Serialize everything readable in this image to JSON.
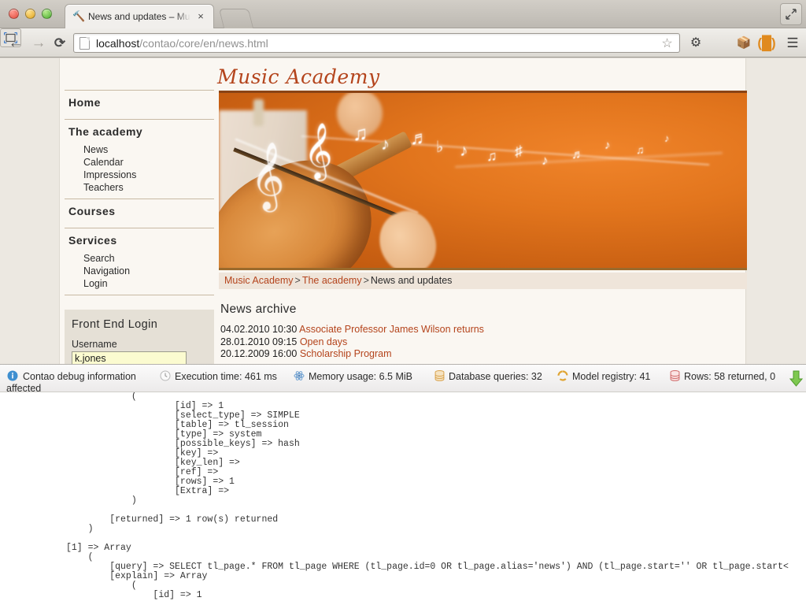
{
  "browser": {
    "window_controls": [
      "close",
      "minimize",
      "zoom"
    ],
    "expand_button": "fullscreen-expand",
    "tab": {
      "favicon": "hammer-icon",
      "title": "News and updates – Music Academy",
      "close_label": "×"
    },
    "new_tab_label": "",
    "nav": {
      "back": "←",
      "forward": "→",
      "reload": "⟳"
    },
    "omnibox": {
      "url_host": "localhost",
      "url_path": "/contao/core/en/news.html",
      "page_icon": "document-icon",
      "star": "☆"
    },
    "extensions": {
      "gear": "⚙",
      "frame": "screenshot-frame-icon",
      "box": "📦",
      "bracket": "(█)",
      "menu": "☰"
    }
  },
  "site": {
    "logo": "Music Academy",
    "nav": [
      {
        "label": "Home",
        "children": []
      },
      {
        "label": "The academy",
        "children": [
          "News",
          "Calendar",
          "Impressions",
          "Teachers"
        ]
      },
      {
        "label": "Courses",
        "children": []
      },
      {
        "label": "Services",
        "children": [
          "Search",
          "Navigation",
          "Login"
        ]
      }
    ],
    "login": {
      "title": "Front End Login",
      "username_label": "Username",
      "username_value": "k.jones",
      "username_placeholder": ""
    },
    "banner": {
      "alt": "violin-and-music-notes-banner",
      "notes": [
        "♫",
        "♪",
        "♬",
        "♫",
        "♪",
        "♬",
        "♪",
        "♫",
        "♪",
        "♬",
        "♪",
        "𝄞"
      ]
    },
    "breadcrumb": [
      {
        "label": "Music Academy",
        "link": true
      },
      {
        "label": "The academy",
        "link": true
      },
      {
        "label": "News and updates",
        "link": false
      }
    ],
    "breadcrumb_separator": ">",
    "news": {
      "heading": "News archive",
      "items": [
        {
          "date": "04.02.2010 10:30",
          "title": "Associate Professor James Wilson returns"
        },
        {
          "date": "28.01.2010 09:15",
          "title": "Open days"
        },
        {
          "date": "20.12.2009 16:00",
          "title": "Scholarship Program"
        }
      ]
    }
  },
  "debug_bar": {
    "items": [
      {
        "icon": "info-icon",
        "label": "Contao debug information"
      },
      {
        "icon": "clock-icon",
        "label": "Execution time: 461 ms"
      },
      {
        "icon": "memory-icon",
        "label": "Memory usage: 6.5 MiB"
      },
      {
        "icon": "database-icon",
        "label": "Database queries: 32"
      },
      {
        "icon": "registry-icon",
        "label": "Model registry: 41"
      },
      {
        "icon": "rows-icon",
        "label": "Rows: 58 returned, 0"
      }
    ],
    "wrapped_text": "affected",
    "toggle_icon": "green-down-arrow-icon"
  },
  "debug_output": {
    "text": "                    [  ]        =>        \n            (\n                    [id] => 1\n                    [select_type] => SIMPLE\n                    [table] => tl_session\n                    [type] => system\n                    [possible_keys] => hash\n                    [key] => \n                    [key_len] => \n                    [ref] => \n                    [rows] => 1\n                    [Extra] => \n            )\n\n        [returned] => 1 row(s) returned\n    )\n\n[1] => Array\n    (\n        [query] => SELECT tl_page.* FROM tl_page WHERE (tl_page.id=0 OR tl_page.alias='news') AND (tl_page.start='' OR tl_page.start<\n        [explain] => Array\n            (\n                [id] => 1"
  }
}
